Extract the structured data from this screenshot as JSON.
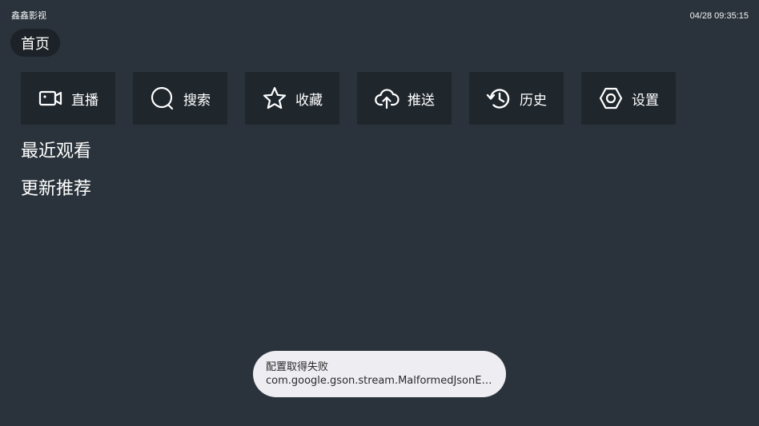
{
  "status_bar": {
    "app_name": "鑫鑫影视",
    "clock": "04/28 09:35:15"
  },
  "nav": {
    "home_label": "首页"
  },
  "quick_buttons": [
    {
      "label": "直播",
      "icon": "video-camera-icon"
    },
    {
      "label": "搜索",
      "icon": "search-icon"
    },
    {
      "label": "收藏",
      "icon": "star-icon"
    },
    {
      "label": "推送",
      "icon": "cloud-upload-icon"
    },
    {
      "label": "历史",
      "icon": "history-icon"
    },
    {
      "label": "设置",
      "icon": "settings-hexagon-icon"
    }
  ],
  "sections": {
    "recent": "最近观看",
    "updates": "更新推荐"
  },
  "toast": {
    "line1": "配置取得失败",
    "line2": "com.google.gson.stream.MalformedJsonEx..."
  },
  "colors": {
    "background": "#2a333b",
    "button_bg": "#1f262c",
    "toast_bg": "#eeedf2"
  }
}
